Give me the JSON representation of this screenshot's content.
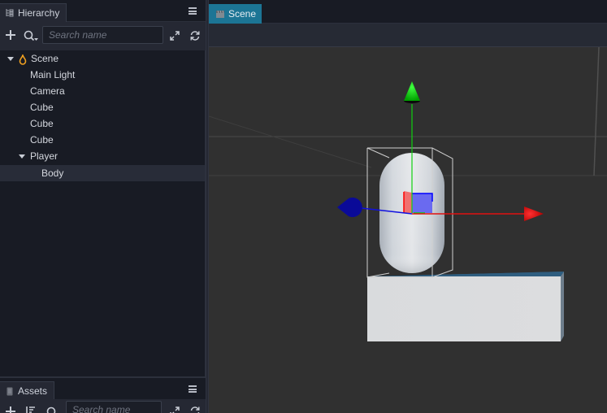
{
  "hierarchy": {
    "tab_label": "Hierarchy",
    "tab_icon": "hierarchy-tree-icon",
    "search_placeholder": "Search name",
    "toolbar_icons": [
      "add-icon",
      "search-filter-icon",
      "expand-icon",
      "refresh-icon"
    ],
    "tree": [
      {
        "label": "Scene",
        "depth": 0,
        "expanded": true,
        "icon": "scene-flame-icon"
      },
      {
        "label": "Main Light",
        "depth": 1
      },
      {
        "label": "Camera",
        "depth": 1
      },
      {
        "label": "Cube",
        "depth": 1
      },
      {
        "label": "Cube",
        "depth": 1
      },
      {
        "label": "Cube",
        "depth": 1
      },
      {
        "label": "Player",
        "depth": 1,
        "expanded": true
      },
      {
        "label": "Body",
        "depth": 2,
        "selected": true
      }
    ]
  },
  "assets": {
    "tab_label": "Assets",
    "tab_icon": "assets-clipboard-icon",
    "search_placeholder": "Search name",
    "toolbar_icons": [
      "add-icon",
      "sort-icon",
      "search-filter-icon",
      "expand-icon",
      "refresh-icon"
    ]
  },
  "scene": {
    "tab_label": "Scene",
    "tab_icon": "scene-clapper-icon",
    "colors": {
      "tab_active": "#1c7595",
      "gizmo_x": "#e01010",
      "gizmo_y": "#10d010",
      "gizmo_z": "#0a0aa0",
      "viewport_bg": "#303030"
    },
    "objects": [
      "capsule-body",
      "ground-cube",
      "transform-gizmo",
      "bounding-box"
    ]
  }
}
